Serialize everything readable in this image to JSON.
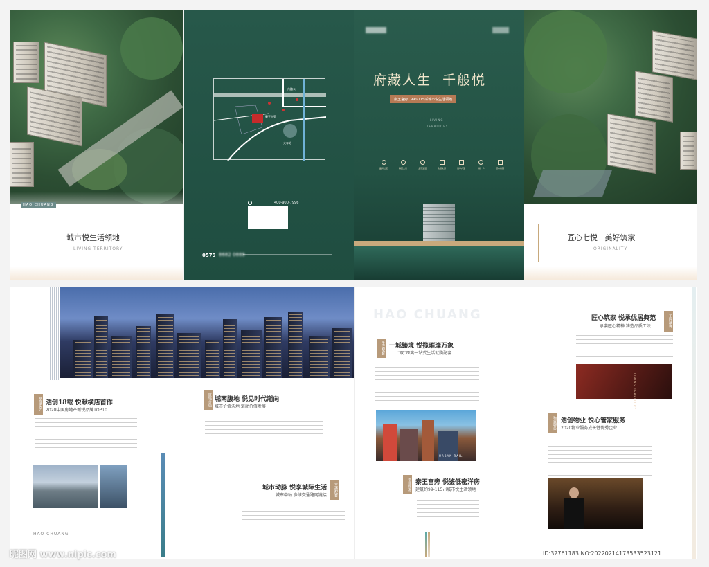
{
  "top": {
    "p1": {
      "brand": "HAO CHUANG",
      "title": "城市悦生活领地",
      "subtitle": "LIVING TERRITORY"
    },
    "p2": {
      "map_labels": [
        "六路公",
        "秦王宫旁",
        "火车站"
      ],
      "phone": "400-900-7996",
      "code_prefix": "0579",
      "code_value": "8682 0888"
    },
    "p3": {
      "headline": "府藏人生  千般悦",
      "tag_name": "秦王宫旁",
      "tag_text": "99~115㎡城市悦生活领地",
      "eng1": "LIVING",
      "eng2": "TERRITORY",
      "icons": [
        {
          "name": "location-icon",
          "label": "品牌社区"
        },
        {
          "name": "hospital-icon",
          "label": "精装交付"
        },
        {
          "name": "gear-icon",
          "label": "全景生活"
        },
        {
          "name": "building-icon",
          "label": "轨道交通"
        },
        {
          "name": "home-icon",
          "label": "创享户型"
        },
        {
          "name": "pin-icon",
          "label": "一梯一户"
        },
        {
          "name": "box-icon",
          "label": "核心商圈"
        }
      ]
    },
    "p4": {
      "title": "匠心七悦   美好筑家",
      "subtitle": "ORIGINALITY"
    }
  },
  "bottom": {
    "left": {
      "sec1_title": "浩创18载  悦献横店首作",
      "sec1_sub": "2020中国房地产新锐品牌TOP10",
      "sec1_seal": "品牌实力",
      "sec2_title": "城南腹地  悦见时代潮向",
      "sec2_sub": "城市价值沃地   驱动价值发展",
      "sec2_seal": "区域价值",
      "sec3_title": "城市动脉  悦享城际生活",
      "sec3_sub": "城市中轴   多维交通路网链接",
      "sec3_seal": "交通配套",
      "brand": "HAO CHUANG"
    },
    "right": {
      "watermark": "HAO CHUANG",
      "sec1_title": "一城臻境  悦揽璀璨万象",
      "sec1_sub": "“双”距离一站式生活就购配套",
      "sec1_seal": "生活配套",
      "urban_label": "URBAN RAIL",
      "sec2_title": "秦王宫旁  悦鉴低密洋房",
      "sec2_sub": "建筑约99-115㎡城市悦生活领地",
      "sec2_seal": "项目概况",
      "sec3_title": "匠心筑家  悦承优居典范",
      "sec3_sub": "承袭匠心精神   铸造品质工法",
      "sec3_seal": "工匠精神",
      "sec4_title": "浩创物业  悦心管家服务",
      "sec4_sub": "2020物业服务成长性优秀企业",
      "sec4_seal": "物业服务",
      "rotated": "LIVING TERRITORY"
    }
  },
  "footer": {
    "wm_left": "昵图网 www.nipic.com",
    "wm_right": "ID:32761183 NO:20220214173533523121"
  },
  "colors": {
    "green": "#235244",
    "gold": "#c8a97c",
    "copper": "#b88a62"
  }
}
